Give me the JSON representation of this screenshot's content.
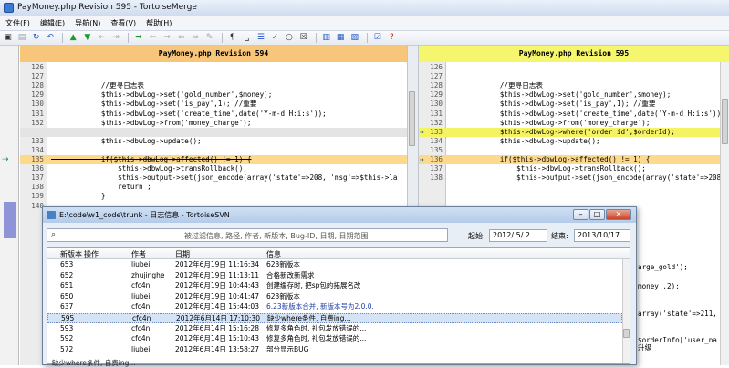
{
  "window": {
    "title": "PayMoney.php Revision 595 - TortoiseMerge"
  },
  "menu": [
    "文件(F)",
    "编辑(E)",
    "导航(N)",
    "查看(V)",
    "帮助(H)"
  ],
  "toolbar_icons": [
    "save-icon",
    "save-as-icon",
    "refresh-icon",
    "undo-icon",
    "nav-up-icon",
    "nav-down-icon",
    "nav-first-icon",
    "nav-last-icon",
    "nav-prev-conflict-icon",
    "nav-next-conflict-icon",
    "marker-icon",
    "use-theirs-icon",
    "use-mine-icon",
    "use-block-icon",
    "show-whitespace-icon",
    "pilcrow-icon",
    "collapse-icon",
    "check-icon",
    "circle-icon",
    "cross-box-icon",
    "one-pane-icon",
    "two-pane-icon",
    "three-pane-icon",
    "settings-icon",
    "help-icon"
  ],
  "left_pane": {
    "header": "PayMoney.php Revision 594",
    "lines": [
      {
        "n": "126",
        "t": "",
        "s": "normal"
      },
      {
        "n": "127",
        "t": "",
        "s": "normal"
      },
      {
        "n": "128",
        "t": "            //更寻日志表",
        "s": "normal"
      },
      {
        "n": "129",
        "t": "            $this->dbwLog->set('gold_number',$money);",
        "s": "normal"
      },
      {
        "n": "130",
        "t": "            $this->dbwLog->set('is_pay',1); //重要",
        "s": "normal"
      },
      {
        "n": "131",
        "t": "            $this->dbwLog->set('create_time',date('Y-m-d H:i:s'));",
        "s": "normal"
      },
      {
        "n": "132",
        "t": "            $this->dbwLog->from('money_charge');",
        "s": "normal"
      },
      {
        "n": "",
        "t": "",
        "s": "empty"
      },
      {
        "n": "133",
        "t": "            $this->dbwLog->update();",
        "s": "normal"
      },
      {
        "n": "134",
        "t": "",
        "s": "normal"
      },
      {
        "n": "135",
        "t": "            if($this->dbwLog->affected() != 1) {",
        "s": "changed"
      },
      {
        "n": "136",
        "t": "                $this->dbwLog->transRollback();",
        "s": "normal"
      },
      {
        "n": "137",
        "t": "                $this->output->set(json_encode(array('state'=>208, 'msg'=>$this->la",
        "s": "normal"
      },
      {
        "n": "138",
        "t": "                return ;",
        "s": "normal"
      },
      {
        "n": "139",
        "t": "            }",
        "s": "normal"
      },
      {
        "n": "140",
        "t": "",
        "s": "normal"
      }
    ]
  },
  "right_pane": {
    "header": "PayMoney.php Revision 595",
    "lines": [
      {
        "n": "126",
        "t": "",
        "s": "normal",
        "m": ""
      },
      {
        "n": "127",
        "t": "",
        "s": "normal",
        "m": ""
      },
      {
        "n": "128",
        "t": "            //更寻日志表",
        "s": "normal",
        "m": ""
      },
      {
        "n": "129",
        "t": "            $this->dbwLog->set('gold_number',$money);",
        "s": "normal",
        "m": ""
      },
      {
        "n": "130",
        "t": "            $this->dbwLog->set('is_pay',1); //重要",
        "s": "normal",
        "m": ""
      },
      {
        "n": "131",
        "t": "            $this->dbwLog->set('create_time',date('Y-m-d H:i:s'));",
        "s": "normal",
        "m": ""
      },
      {
        "n": "132",
        "t": "            $this->dbwLog->from('money_charge');",
        "s": "normal",
        "m": ""
      },
      {
        "n": "133",
        "t": "            $this->dbwLog->where('order id',$orderId);",
        "s": "added",
        "m": "+"
      },
      {
        "n": "134",
        "t": "            $this->dbwLog->update();",
        "s": "normal",
        "m": ""
      },
      {
        "n": "135",
        "t": "",
        "s": "normal",
        "m": ""
      },
      {
        "n": "136",
        "t": "            if($this->dbwLog->affected() != 1) {",
        "s": "changed",
        "m": "+"
      },
      {
        "n": "137",
        "t": "                $this->dbwLog->transRollback();",
        "s": "normal",
        "m": ""
      },
      {
        "n": "138",
        "t": "                $this->output->set(json_encode(array('state'=>208, 'msg'=>$this->la",
        "s": "normal",
        "m": ""
      }
    ],
    "overflow_fragments": [
      "arge_gold');",
      "money ,2);",
      "array('state'=>211,",
      "升级",
      "$orderInfo['user_na"
    ]
  },
  "log_dialog": {
    "title": "E:\\code\\w1_code\\trunk - 日志信息 - TortoiseSVN",
    "search_placeholder": "被过滤信息, 路径, 作者, 新版本, Bug-ID, 日期, 日期范围",
    "from_label": "起始:",
    "from_date": "2012/ 5/ 2",
    "to_label": "结束:",
    "to_date": "2013/10/17",
    "columns": [
      "新版本",
      "操作",
      "作者",
      "日期",
      "信息"
    ],
    "rows": [
      {
        "rev": "653",
        "author": "liubei",
        "date": "2012年6月19日 11:16:34",
        "msg": "623新版本",
        "sel": false,
        "extra": ""
      },
      {
        "rev": "652",
        "author": "zhujinghe",
        "date": "2012年6月19日 11:13:11",
        "msg": "合格新改新需求",
        "sel": false,
        "extra": ""
      },
      {
        "rev": "651",
        "author": "cfc4n",
        "date": "2012年6月19日 10:44:43",
        "msg": "创建缓存时, 把sp包的拓展名改",
        "sel": false,
        "extra": ""
      },
      {
        "rev": "650",
        "author": "liubei",
        "date": "2012年6月19日 10:41:47",
        "msg": "623新版本",
        "sel": false,
        "extra": "add"
      },
      {
        "rev": "637",
        "author": "cfc4n",
        "date": "2012年6月14日 15:44:03",
        "msg": "6.23新版本合并, 新版本号为2.0.0...",
        "sel": false,
        "extra": "",
        "blue": true
      },
      {
        "rev": "595",
        "author": "cfc4n",
        "date": "2012年6月14日 17:10:30",
        "msg": "缺少where条件, 自费ing...",
        "sel": true,
        "extra": "both"
      },
      {
        "rev": "593",
        "author": "cfc4n",
        "date": "2012年6月14日 15:16:28",
        "msg": "修复多角色时, 礼包发放错误的...",
        "sel": false,
        "extra": ""
      },
      {
        "rev": "592",
        "author": "cfc4n",
        "date": "2012年6月14日 15:10:43",
        "msg": "修复多角色时, 礼包发放错误的...",
        "sel": false,
        "extra": ""
      },
      {
        "rev": "572",
        "author": "liubei",
        "date": "2012年6月14日 13:58:27",
        "msg": "部分显示BUG",
        "sel": false,
        "extra": ""
      }
    ],
    "status_message": "缺少where条件, 自费ing..."
  },
  "colors": {
    "changed": "#fcd98c",
    "added": "#f6f363",
    "left_header": "#f7c67a",
    "right_header": "#f5f56e"
  }
}
